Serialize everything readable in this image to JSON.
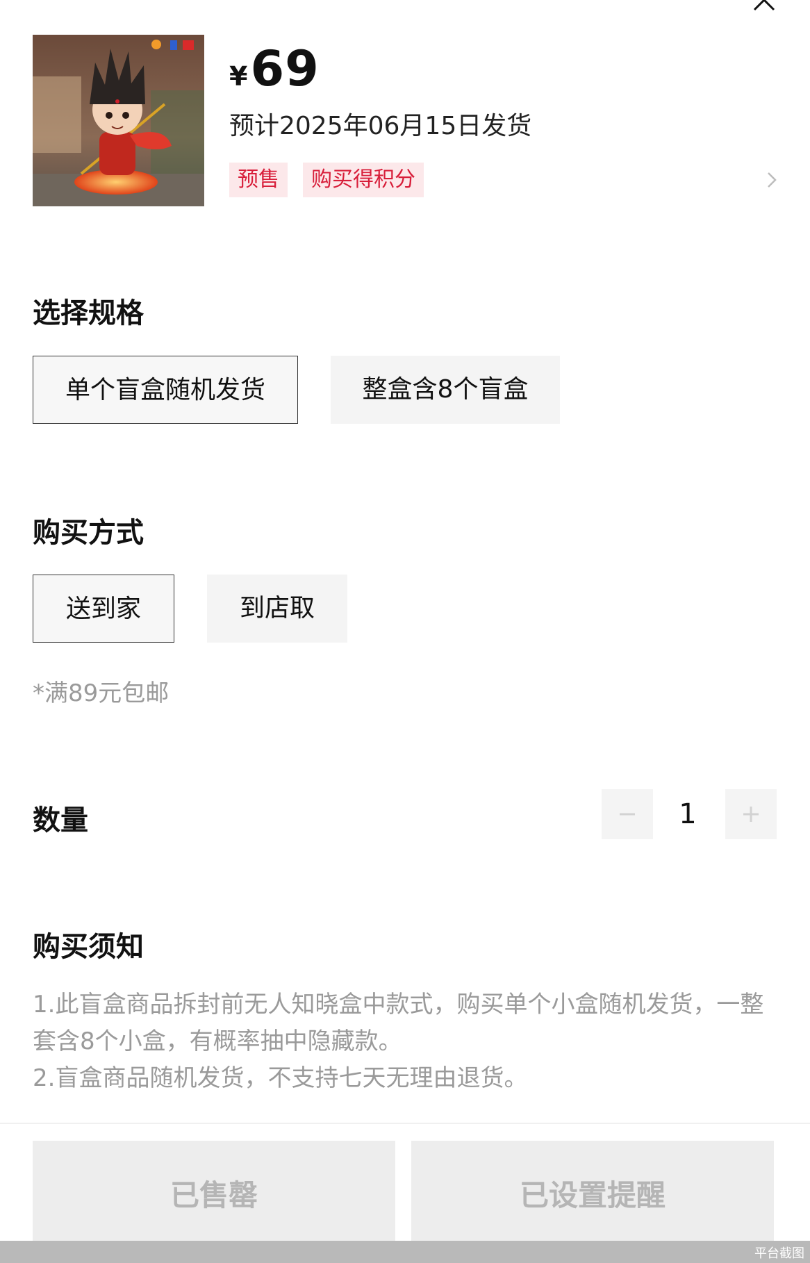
{
  "product": {
    "currency": "¥",
    "price": "69",
    "ship_date": "预计2025年06月15日发货",
    "tags": [
      "预售",
      "购买得积分"
    ]
  },
  "spec": {
    "title": "选择规格",
    "options": [
      "单个盲盒随机发货",
      "整盒含8个盲盒"
    ],
    "selected": "单个盲盒随机发货"
  },
  "delivery": {
    "title": "购买方式",
    "options": [
      "送到家",
      "到店取"
    ],
    "selected": "送到家",
    "note": "*满89元包邮"
  },
  "quantity": {
    "title": "数量",
    "value": "1"
  },
  "notice": {
    "title": "购买须知",
    "lines": [
      "1.此盲盒商品拆封前无人知晓盒中款式，购买单个小盒随机发货，一整套含8个小盒，有概率抽中隐藏款。",
      "2.盲盒商品随机发货，不支持七天无理由退货。"
    ]
  },
  "buttons": {
    "sold_out": "已售罄",
    "reminder": "已设置提醒"
  },
  "watermark": "平台截图",
  "colors": {
    "tag_bg": "#fce8ea",
    "tag_text": "#d81e3a",
    "option_bg": "#f4f4f4",
    "disabled_button_bg": "#ededed",
    "disabled_button_text": "#b5b5b5"
  }
}
